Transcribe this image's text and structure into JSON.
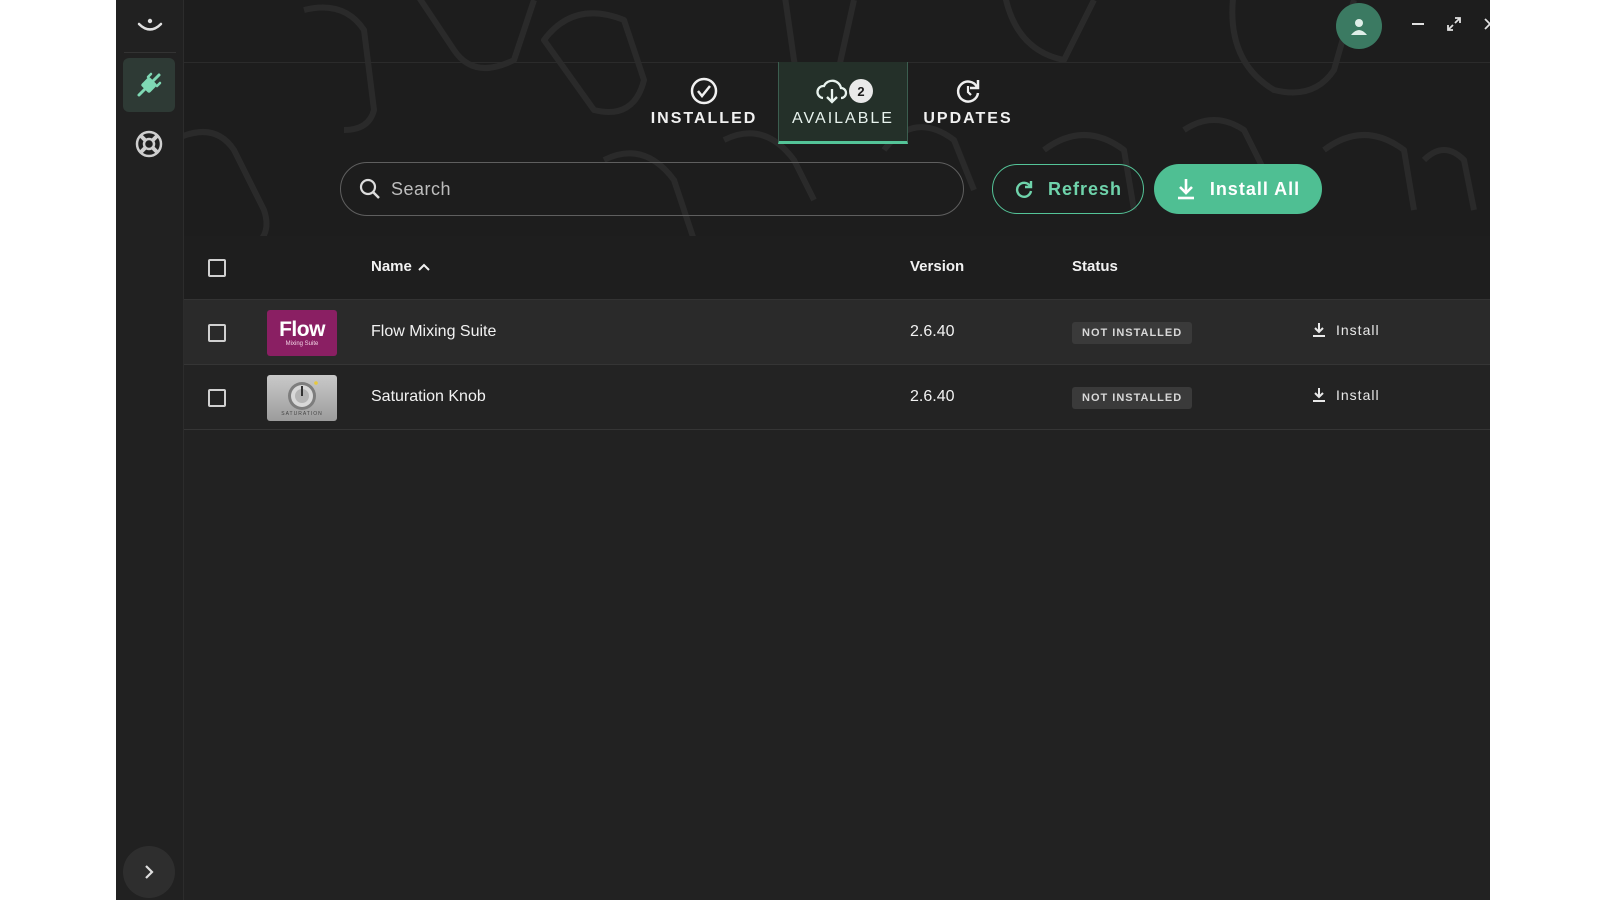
{
  "tabs": [
    {
      "label": "INSTALLED",
      "icon": "check-circle-icon"
    },
    {
      "label": "AVAILABLE",
      "icon": "cloud-download-icon",
      "badge": "2"
    },
    {
      "label": "UPDATES",
      "icon": "refresh-circle-icon"
    }
  ],
  "toolbar": {
    "search_placeholder": "Search",
    "refresh_label": "Refresh",
    "install_all_label": "Install All"
  },
  "table": {
    "headers": {
      "name": "Name",
      "version": "Version",
      "status": "Status"
    },
    "rows": [
      {
        "name": "Flow Mixing Suite",
        "version": "2.6.40",
        "status": "NOT INSTALLED",
        "action": "Install",
        "thumb_title": "Flow",
        "thumb_sub": "Mixing Suite"
      },
      {
        "name": "Saturation Knob",
        "version": "2.6.40",
        "status": "NOT INSTALLED",
        "action": "Install",
        "thumb_sub": "SATURATION"
      }
    ]
  },
  "colors": {
    "accent": "#4fbf93",
    "background": "#1b1b1b",
    "flow_thumb": "#8a1f63"
  }
}
